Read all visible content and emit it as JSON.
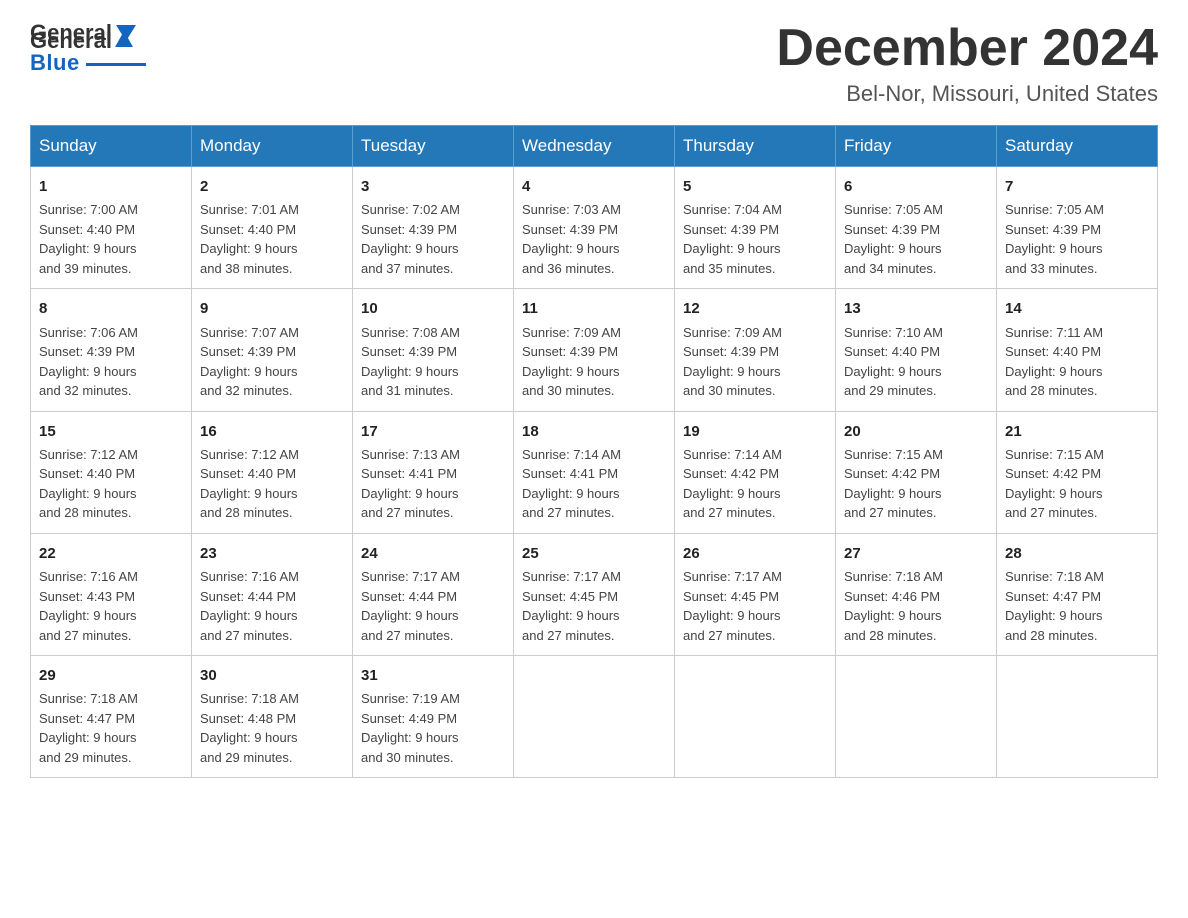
{
  "header": {
    "logo_general": "General",
    "logo_blue": "Blue",
    "month_title": "December 2024",
    "location": "Bel-Nor, Missouri, United States"
  },
  "days_of_week": [
    "Sunday",
    "Monday",
    "Tuesday",
    "Wednesday",
    "Thursday",
    "Friday",
    "Saturday"
  ],
  "weeks": [
    [
      {
        "day": "1",
        "sunrise": "7:00 AM",
        "sunset": "4:40 PM",
        "daylight": "9 hours and 39 minutes."
      },
      {
        "day": "2",
        "sunrise": "7:01 AM",
        "sunset": "4:40 PM",
        "daylight": "9 hours and 38 minutes."
      },
      {
        "day": "3",
        "sunrise": "7:02 AM",
        "sunset": "4:39 PM",
        "daylight": "9 hours and 37 minutes."
      },
      {
        "day": "4",
        "sunrise": "7:03 AM",
        "sunset": "4:39 PM",
        "daylight": "9 hours and 36 minutes."
      },
      {
        "day": "5",
        "sunrise": "7:04 AM",
        "sunset": "4:39 PM",
        "daylight": "9 hours and 35 minutes."
      },
      {
        "day": "6",
        "sunrise": "7:05 AM",
        "sunset": "4:39 PM",
        "daylight": "9 hours and 34 minutes."
      },
      {
        "day": "7",
        "sunrise": "7:05 AM",
        "sunset": "4:39 PM",
        "daylight": "9 hours and 33 minutes."
      }
    ],
    [
      {
        "day": "8",
        "sunrise": "7:06 AM",
        "sunset": "4:39 PM",
        "daylight": "9 hours and 32 minutes."
      },
      {
        "day": "9",
        "sunrise": "7:07 AM",
        "sunset": "4:39 PM",
        "daylight": "9 hours and 32 minutes."
      },
      {
        "day": "10",
        "sunrise": "7:08 AM",
        "sunset": "4:39 PM",
        "daylight": "9 hours and 31 minutes."
      },
      {
        "day": "11",
        "sunrise": "7:09 AM",
        "sunset": "4:39 PM",
        "daylight": "9 hours and 30 minutes."
      },
      {
        "day": "12",
        "sunrise": "7:09 AM",
        "sunset": "4:39 PM",
        "daylight": "9 hours and 30 minutes."
      },
      {
        "day": "13",
        "sunrise": "7:10 AM",
        "sunset": "4:40 PM",
        "daylight": "9 hours and 29 minutes."
      },
      {
        "day": "14",
        "sunrise": "7:11 AM",
        "sunset": "4:40 PM",
        "daylight": "9 hours and 28 minutes."
      }
    ],
    [
      {
        "day": "15",
        "sunrise": "7:12 AM",
        "sunset": "4:40 PM",
        "daylight": "9 hours and 28 minutes."
      },
      {
        "day": "16",
        "sunrise": "7:12 AM",
        "sunset": "4:40 PM",
        "daylight": "9 hours and 28 minutes."
      },
      {
        "day": "17",
        "sunrise": "7:13 AM",
        "sunset": "4:41 PM",
        "daylight": "9 hours and 27 minutes."
      },
      {
        "day": "18",
        "sunrise": "7:14 AM",
        "sunset": "4:41 PM",
        "daylight": "9 hours and 27 minutes."
      },
      {
        "day": "19",
        "sunrise": "7:14 AM",
        "sunset": "4:42 PM",
        "daylight": "9 hours and 27 minutes."
      },
      {
        "day": "20",
        "sunrise": "7:15 AM",
        "sunset": "4:42 PM",
        "daylight": "9 hours and 27 minutes."
      },
      {
        "day": "21",
        "sunrise": "7:15 AM",
        "sunset": "4:42 PM",
        "daylight": "9 hours and 27 minutes."
      }
    ],
    [
      {
        "day": "22",
        "sunrise": "7:16 AM",
        "sunset": "4:43 PM",
        "daylight": "9 hours and 27 minutes."
      },
      {
        "day": "23",
        "sunrise": "7:16 AM",
        "sunset": "4:44 PM",
        "daylight": "9 hours and 27 minutes."
      },
      {
        "day": "24",
        "sunrise": "7:17 AM",
        "sunset": "4:44 PM",
        "daylight": "9 hours and 27 minutes."
      },
      {
        "day": "25",
        "sunrise": "7:17 AM",
        "sunset": "4:45 PM",
        "daylight": "9 hours and 27 minutes."
      },
      {
        "day": "26",
        "sunrise": "7:17 AM",
        "sunset": "4:45 PM",
        "daylight": "9 hours and 27 minutes."
      },
      {
        "day": "27",
        "sunrise": "7:18 AM",
        "sunset": "4:46 PM",
        "daylight": "9 hours and 28 minutes."
      },
      {
        "day": "28",
        "sunrise": "7:18 AM",
        "sunset": "4:47 PM",
        "daylight": "9 hours and 28 minutes."
      }
    ],
    [
      {
        "day": "29",
        "sunrise": "7:18 AM",
        "sunset": "4:47 PM",
        "daylight": "9 hours and 29 minutes."
      },
      {
        "day": "30",
        "sunrise": "7:18 AM",
        "sunset": "4:48 PM",
        "daylight": "9 hours and 29 minutes."
      },
      {
        "day": "31",
        "sunrise": "7:19 AM",
        "sunset": "4:49 PM",
        "daylight": "9 hours and 30 minutes."
      },
      null,
      null,
      null,
      null
    ]
  ],
  "labels": {
    "sunrise_prefix": "Sunrise: ",
    "sunset_prefix": "Sunset: ",
    "daylight_prefix": "Daylight: "
  }
}
